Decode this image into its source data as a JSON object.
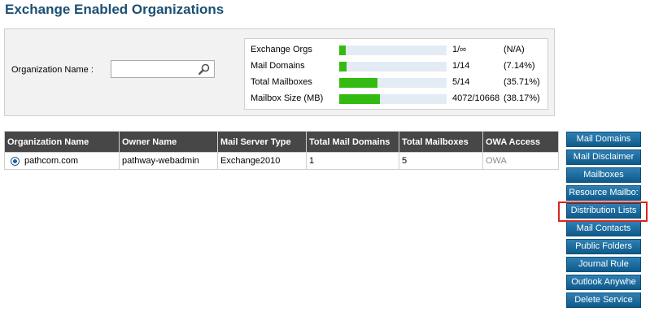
{
  "page": {
    "title": "Exchange Enabled Organizations"
  },
  "filter": {
    "org_label": "Organization Name :",
    "search_value": "",
    "search_icon": "magnifier-icon"
  },
  "stats": [
    {
      "label": "Exchange Orgs",
      "count": "1/∞",
      "pct": "(N/A)",
      "fill": 0.06
    },
    {
      "label": "Mail Domains",
      "count": "1/14",
      "pct": "(7.14%)",
      "fill": 0.0714
    },
    {
      "label": "Total Mailboxes",
      "count": "5/14",
      "pct": "(35.71%)",
      "fill": 0.3571
    },
    {
      "label": "Mailbox Size (MB)",
      "count": "4072/10668",
      "pct": "(38.17%)",
      "fill": 0.3817
    }
  ],
  "table": {
    "columns": [
      "Organization Name",
      "Owner Name",
      "Mail Server Type",
      "Total Mail Domains",
      "Total Mailboxes",
      "OWA Access"
    ],
    "rows": [
      {
        "org": "pathcom.com",
        "owner": "pathway-webadmin",
        "server": "Exchange2010",
        "domains": "1",
        "mailboxes": "5",
        "owa": "OWA"
      }
    ]
  },
  "actions": [
    "Mail Domains",
    "Mail Disclaimer",
    "Mailboxes",
    "Resource Mailbo:",
    "Distribution Lists",
    "Mail Contacts",
    "Public Folders",
    "Journal Rule",
    "Outlook Anywhe",
    "Delete Service"
  ],
  "colors": {
    "title": "#1d4f73",
    "bar_fill": "#33bb11",
    "bar_track": "#e3ecf5",
    "button": "#0e5b8a",
    "highlight": "#d9261c"
  }
}
